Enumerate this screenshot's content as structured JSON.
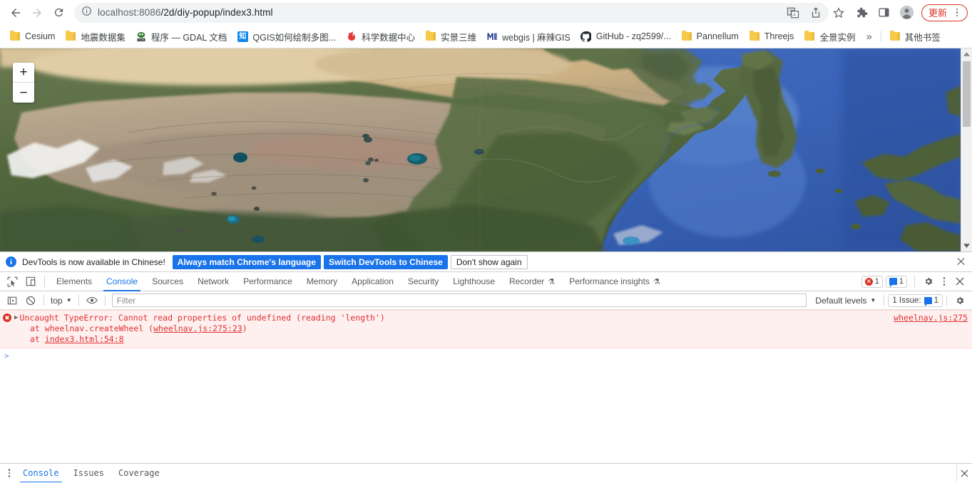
{
  "browser": {
    "nav": {
      "back": "back-arrow",
      "forward": "forward-arrow",
      "reload": "reload"
    },
    "omnibox": {
      "site_info_icon": "info-circle-icon",
      "url_host": "localhost:8086",
      "url_path": "/2d/diy-popup/index3.html",
      "full_url": "localhost:8086/2d/diy-popup/index3.html"
    },
    "right_icons": [
      {
        "name": "translate-icon",
        "label": "Translate"
      },
      {
        "name": "share-icon",
        "label": "Share"
      },
      {
        "name": "bookmark-star-icon",
        "label": "Bookmark"
      },
      {
        "name": "extensions-puzzle-icon",
        "label": "Extensions"
      },
      {
        "name": "side-panel-icon",
        "label": "Side panel"
      },
      {
        "name": "profile-avatar",
        "label": "Profile"
      }
    ],
    "update_button": {
      "label": "更新",
      "menu_icon": "kebab-menu-icon",
      "color": "#d93025"
    }
  },
  "bookmarks": {
    "items": [
      {
        "label": "Cesium",
        "icon": "folder-icon"
      },
      {
        "label": "地震数据集",
        "icon": "folder-icon"
      },
      {
        "label": "程序 — GDAL 文档",
        "icon": "gdal-icon"
      },
      {
        "label": "QGIS如何绘制多图...",
        "icon": "zhihu-icon"
      },
      {
        "label": "科学数据中心",
        "icon": "science-data-icon"
      },
      {
        "label": "实景三维",
        "icon": "folder-icon"
      },
      {
        "label": "webgis | 麻辣GIS",
        "icon": "malagis-icon"
      },
      {
        "label": "GitHub - zq2599/...",
        "icon": "github-icon"
      },
      {
        "label": "Pannellum",
        "icon": "folder-icon"
      },
      {
        "label": "Threejs",
        "icon": "folder-icon"
      },
      {
        "label": "全景实例",
        "icon": "folder-icon"
      }
    ],
    "overflow_label": "»",
    "other_bookmarks": {
      "label": "其他书签",
      "icon": "folder-icon"
    }
  },
  "map": {
    "zoom_in": "+",
    "zoom_out": "−",
    "description": "Satellite basemap of East Asia - Tibetan Plateau, China, Korean Peninsula and Japan",
    "scrollbar": {
      "up_arrow": "▲",
      "down_arrow": "▼"
    }
  },
  "devtools_notification": {
    "icon": "info-icon",
    "message": "DevTools is now available in Chinese!",
    "buttons": [
      {
        "label": "Always match Chrome's language",
        "style": "primary"
      },
      {
        "label": "Switch DevTools to Chinese",
        "style": "primary"
      },
      {
        "label": "Don't show again",
        "style": "secondary"
      }
    ],
    "close_icon": "close-icon"
  },
  "devtools": {
    "left_icons": [
      {
        "name": "inspect-element-icon"
      },
      {
        "name": "device-toolbar-icon"
      }
    ],
    "tabs": [
      {
        "label": "Elements",
        "active": false,
        "beaker": false
      },
      {
        "label": "Console",
        "active": true,
        "beaker": false
      },
      {
        "label": "Sources",
        "active": false,
        "beaker": false
      },
      {
        "label": "Network",
        "active": false,
        "beaker": false
      },
      {
        "label": "Performance",
        "active": false,
        "beaker": false
      },
      {
        "label": "Memory",
        "active": false,
        "beaker": false
      },
      {
        "label": "Application",
        "active": false,
        "beaker": false
      },
      {
        "label": "Security",
        "active": false,
        "beaker": false
      },
      {
        "label": "Lighthouse",
        "active": false,
        "beaker": false
      },
      {
        "label": "Recorder",
        "active": false,
        "beaker": true
      },
      {
        "label": "Performance insights",
        "active": false,
        "beaker": true
      }
    ],
    "error_badge": "1",
    "message_badge": "1",
    "settings_icon": "gear-icon",
    "more_icon": "kebab-menu-icon",
    "close_icon": "close-icon"
  },
  "console_toolbar": {
    "sidebar_toggle_icon": "show-console-sidebar-icon",
    "clear_icon": "clear-console-icon",
    "context": "top",
    "context_caret": "▼",
    "eye_icon": "live-expression-eye-icon",
    "filter_placeholder": "Filter",
    "filter_value": "",
    "levels_label": "Default levels",
    "levels_caret": "▼",
    "issues_label": "1 Issue:",
    "issues_count": "1",
    "settings_icon": "gear-icon"
  },
  "console": {
    "error": {
      "expand_caret": "▶",
      "message": "Uncaught TypeError: Cannot read properties of undefined (reading 'length')",
      "stack": [
        {
          "prefix": "    at wheelnav.createWheel (",
          "link": "wheelnav.js:275:23",
          "suffix": ")"
        },
        {
          "prefix": "    at ",
          "link": "index3.html:54:8",
          "suffix": ""
        }
      ],
      "source_link": "wheelnav.js:275"
    },
    "prompt": ">"
  },
  "drawer": {
    "more_icon": "kebab-menu-icon",
    "tabs": [
      {
        "label": "Console",
        "active": true
      },
      {
        "label": "Issues",
        "active": false
      },
      {
        "label": "Coverage",
        "active": false
      }
    ],
    "close_icon": "close-icon"
  },
  "colors": {
    "accent_blue": "#1a73e8",
    "error_red": "#d93025",
    "error_bg": "#fff0f0",
    "chrome_gray": "#f1f3f4"
  }
}
